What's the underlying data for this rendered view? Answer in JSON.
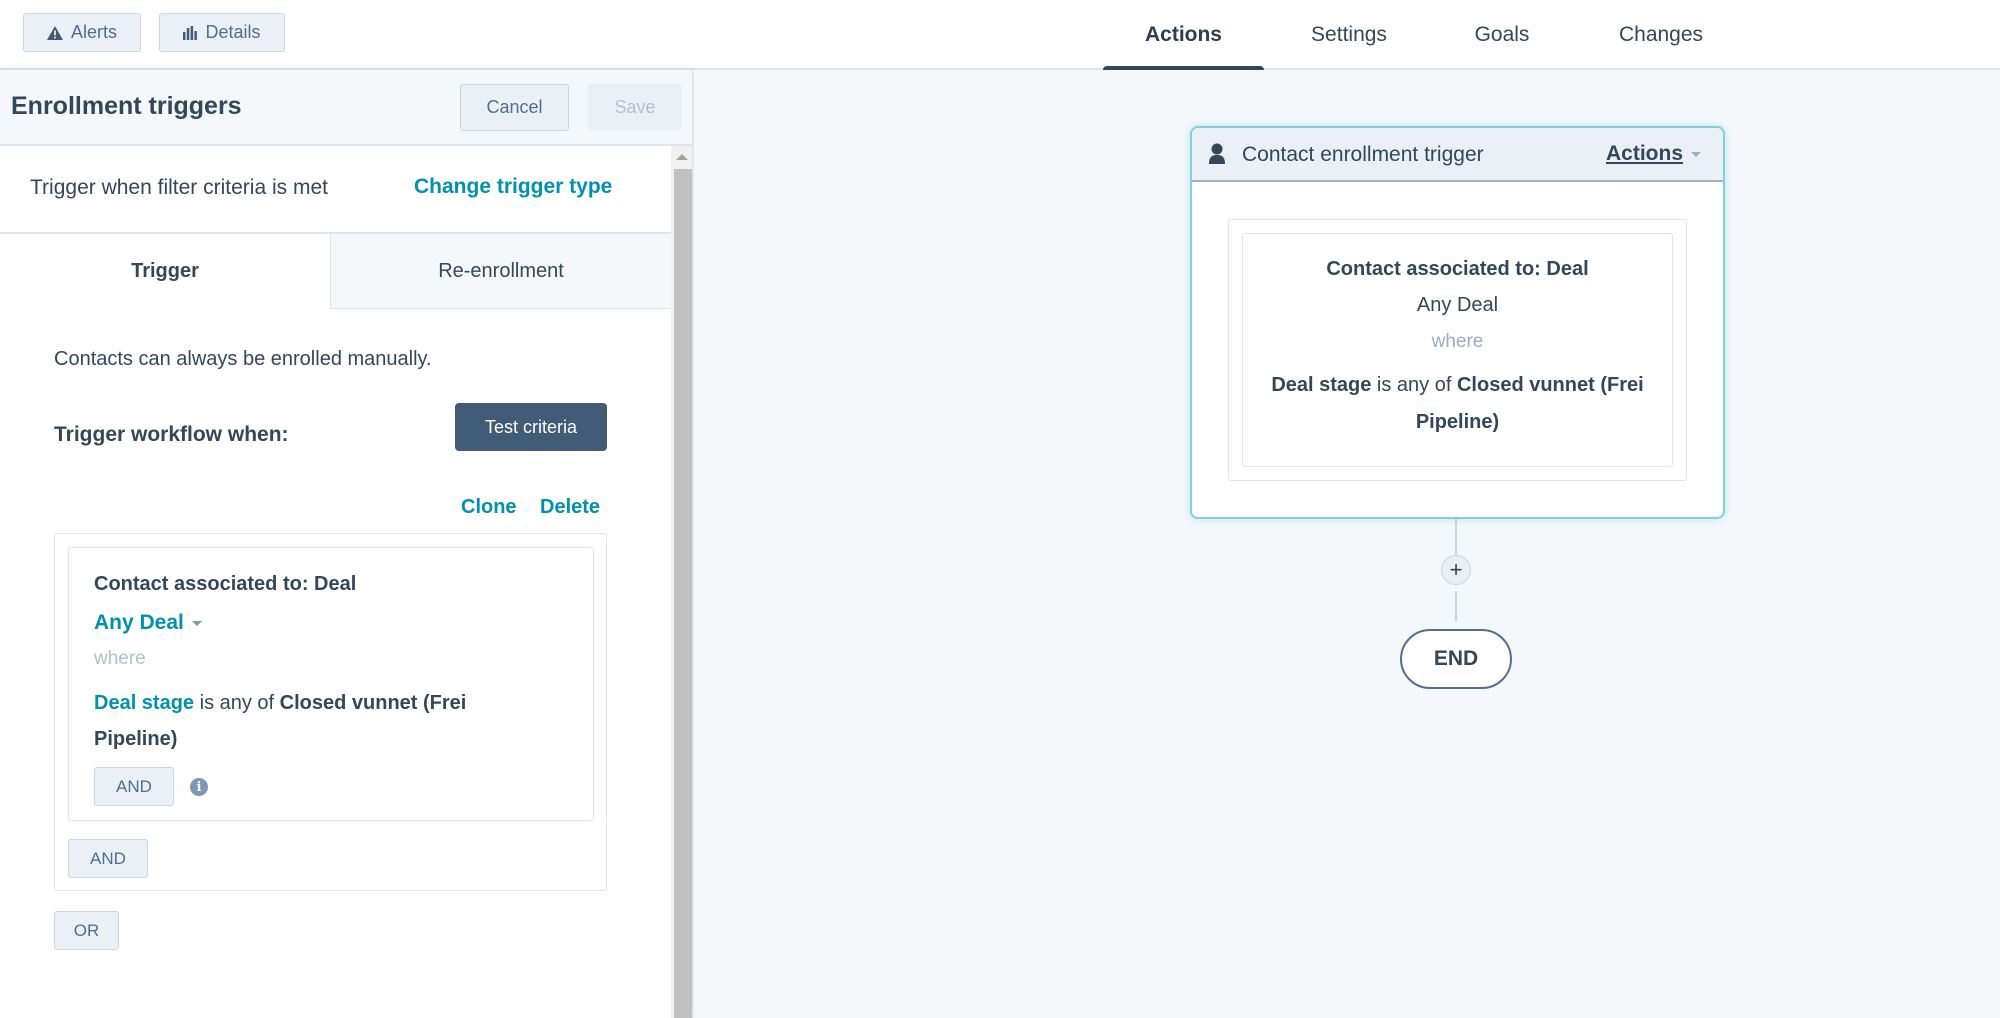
{
  "topbar": {
    "alerts_label": "Alerts",
    "alerts_icon": "warning-triangle-icon",
    "details_label": "Details",
    "details_icon": "bar-chart-icon",
    "tabs": [
      {
        "label": "Actions",
        "active": true
      },
      {
        "label": "Settings",
        "active": false
      },
      {
        "label": "Goals",
        "active": false
      },
      {
        "label": "Changes",
        "active": false
      }
    ]
  },
  "panel": {
    "title": "Enrollment triggers",
    "cancel_label": "Cancel",
    "save_label": "Save",
    "trigger_type_text": "Trigger when filter criteria is met",
    "change_trigger_label": "Change trigger type",
    "subtabs": [
      {
        "label": "Trigger",
        "active": true
      },
      {
        "label": "Re-enrollment",
        "active": false
      }
    ],
    "manual_text": "Contacts can always be enrolled manually.",
    "trigger_when_label": "Trigger workflow when:",
    "test_criteria_label": "Test criteria",
    "clone_label": "Clone",
    "delete_label": "Delete",
    "filter": {
      "title": "Contact associated to: Deal",
      "object_select": "Any Deal",
      "where_label": "where",
      "property": "Deal stage",
      "operator": " is any of ",
      "value": "Closed vunnet (Frei Pipeline)",
      "and_inner_label": "AND",
      "info_icon": "info-icon"
    },
    "and_outer_label": "AND",
    "or_label": "OR"
  },
  "canvas": {
    "trigger_node": {
      "icon": "person-icon",
      "title": "Contact enrollment trigger",
      "actions_label": "Actions",
      "filter_title": "Contact associated to: Deal",
      "object": "Any Deal",
      "where_label": "where",
      "property": "Deal stage",
      "operator": " is any of ",
      "value": "Closed vunnet (Frei Pipeline)"
    },
    "add_label": "+",
    "end_label": "END"
  },
  "colors": {
    "accent_link": "#0091ae",
    "primary_dark": "#425b76",
    "node_border": "#7fd1de",
    "text": "#33475b"
  }
}
